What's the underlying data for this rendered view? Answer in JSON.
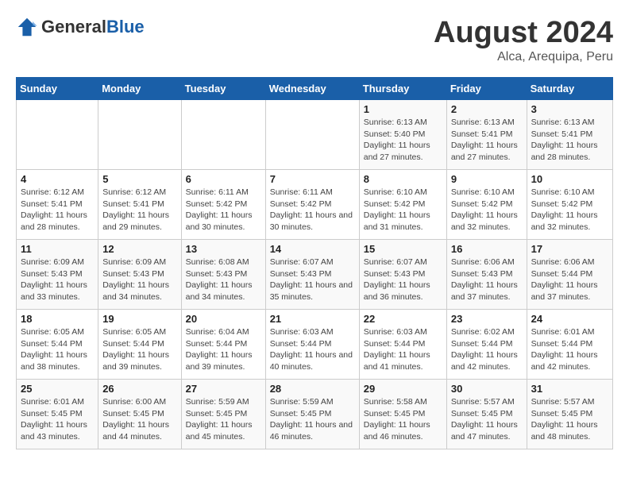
{
  "header": {
    "logo_general": "General",
    "logo_blue": "Blue",
    "main_title": "August 2024",
    "sub_title": "Alca, Arequipa, Peru"
  },
  "days_of_week": [
    "Sunday",
    "Monday",
    "Tuesday",
    "Wednesday",
    "Thursday",
    "Friday",
    "Saturday"
  ],
  "weeks": [
    [
      {
        "num": "",
        "sunrise": "",
        "sunset": "",
        "daylight": ""
      },
      {
        "num": "",
        "sunrise": "",
        "sunset": "",
        "daylight": ""
      },
      {
        "num": "",
        "sunrise": "",
        "sunset": "",
        "daylight": ""
      },
      {
        "num": "",
        "sunrise": "",
        "sunset": "",
        "daylight": ""
      },
      {
        "num": "1",
        "sunrise": "Sunrise: 6:13 AM",
        "sunset": "Sunset: 5:40 PM",
        "daylight": "Daylight: 11 hours and 27 minutes."
      },
      {
        "num": "2",
        "sunrise": "Sunrise: 6:13 AM",
        "sunset": "Sunset: 5:41 PM",
        "daylight": "Daylight: 11 hours and 27 minutes."
      },
      {
        "num": "3",
        "sunrise": "Sunrise: 6:13 AM",
        "sunset": "Sunset: 5:41 PM",
        "daylight": "Daylight: 11 hours and 28 minutes."
      }
    ],
    [
      {
        "num": "4",
        "sunrise": "Sunrise: 6:12 AM",
        "sunset": "Sunset: 5:41 PM",
        "daylight": "Daylight: 11 hours and 28 minutes."
      },
      {
        "num": "5",
        "sunrise": "Sunrise: 6:12 AM",
        "sunset": "Sunset: 5:41 PM",
        "daylight": "Daylight: 11 hours and 29 minutes."
      },
      {
        "num": "6",
        "sunrise": "Sunrise: 6:11 AM",
        "sunset": "Sunset: 5:42 PM",
        "daylight": "Daylight: 11 hours and 30 minutes."
      },
      {
        "num": "7",
        "sunrise": "Sunrise: 6:11 AM",
        "sunset": "Sunset: 5:42 PM",
        "daylight": "Daylight: 11 hours and 30 minutes."
      },
      {
        "num": "8",
        "sunrise": "Sunrise: 6:10 AM",
        "sunset": "Sunset: 5:42 PM",
        "daylight": "Daylight: 11 hours and 31 minutes."
      },
      {
        "num": "9",
        "sunrise": "Sunrise: 6:10 AM",
        "sunset": "Sunset: 5:42 PM",
        "daylight": "Daylight: 11 hours and 32 minutes."
      },
      {
        "num": "10",
        "sunrise": "Sunrise: 6:10 AM",
        "sunset": "Sunset: 5:42 PM",
        "daylight": "Daylight: 11 hours and 32 minutes."
      }
    ],
    [
      {
        "num": "11",
        "sunrise": "Sunrise: 6:09 AM",
        "sunset": "Sunset: 5:43 PM",
        "daylight": "Daylight: 11 hours and 33 minutes."
      },
      {
        "num": "12",
        "sunrise": "Sunrise: 6:09 AM",
        "sunset": "Sunset: 5:43 PM",
        "daylight": "Daylight: 11 hours and 34 minutes."
      },
      {
        "num": "13",
        "sunrise": "Sunrise: 6:08 AM",
        "sunset": "Sunset: 5:43 PM",
        "daylight": "Daylight: 11 hours and 34 minutes."
      },
      {
        "num": "14",
        "sunrise": "Sunrise: 6:07 AM",
        "sunset": "Sunset: 5:43 PM",
        "daylight": "Daylight: 11 hours and 35 minutes."
      },
      {
        "num": "15",
        "sunrise": "Sunrise: 6:07 AM",
        "sunset": "Sunset: 5:43 PM",
        "daylight": "Daylight: 11 hours and 36 minutes."
      },
      {
        "num": "16",
        "sunrise": "Sunrise: 6:06 AM",
        "sunset": "Sunset: 5:43 PM",
        "daylight": "Daylight: 11 hours and 37 minutes."
      },
      {
        "num": "17",
        "sunrise": "Sunrise: 6:06 AM",
        "sunset": "Sunset: 5:44 PM",
        "daylight": "Daylight: 11 hours and 37 minutes."
      }
    ],
    [
      {
        "num": "18",
        "sunrise": "Sunrise: 6:05 AM",
        "sunset": "Sunset: 5:44 PM",
        "daylight": "Daylight: 11 hours and 38 minutes."
      },
      {
        "num": "19",
        "sunrise": "Sunrise: 6:05 AM",
        "sunset": "Sunset: 5:44 PM",
        "daylight": "Daylight: 11 hours and 39 minutes."
      },
      {
        "num": "20",
        "sunrise": "Sunrise: 6:04 AM",
        "sunset": "Sunset: 5:44 PM",
        "daylight": "Daylight: 11 hours and 39 minutes."
      },
      {
        "num": "21",
        "sunrise": "Sunrise: 6:03 AM",
        "sunset": "Sunset: 5:44 PM",
        "daylight": "Daylight: 11 hours and 40 minutes."
      },
      {
        "num": "22",
        "sunrise": "Sunrise: 6:03 AM",
        "sunset": "Sunset: 5:44 PM",
        "daylight": "Daylight: 11 hours and 41 minutes."
      },
      {
        "num": "23",
        "sunrise": "Sunrise: 6:02 AM",
        "sunset": "Sunset: 5:44 PM",
        "daylight": "Daylight: 11 hours and 42 minutes."
      },
      {
        "num": "24",
        "sunrise": "Sunrise: 6:01 AM",
        "sunset": "Sunset: 5:44 PM",
        "daylight": "Daylight: 11 hours and 42 minutes."
      }
    ],
    [
      {
        "num": "25",
        "sunrise": "Sunrise: 6:01 AM",
        "sunset": "Sunset: 5:45 PM",
        "daylight": "Daylight: 11 hours and 43 minutes."
      },
      {
        "num": "26",
        "sunrise": "Sunrise: 6:00 AM",
        "sunset": "Sunset: 5:45 PM",
        "daylight": "Daylight: 11 hours and 44 minutes."
      },
      {
        "num": "27",
        "sunrise": "Sunrise: 5:59 AM",
        "sunset": "Sunset: 5:45 PM",
        "daylight": "Daylight: 11 hours and 45 minutes."
      },
      {
        "num": "28",
        "sunrise": "Sunrise: 5:59 AM",
        "sunset": "Sunset: 5:45 PM",
        "daylight": "Daylight: 11 hours and 46 minutes."
      },
      {
        "num": "29",
        "sunrise": "Sunrise: 5:58 AM",
        "sunset": "Sunset: 5:45 PM",
        "daylight": "Daylight: 11 hours and 46 minutes."
      },
      {
        "num": "30",
        "sunrise": "Sunrise: 5:57 AM",
        "sunset": "Sunset: 5:45 PM",
        "daylight": "Daylight: 11 hours and 47 minutes."
      },
      {
        "num": "31",
        "sunrise": "Sunrise: 5:57 AM",
        "sunset": "Sunset: 5:45 PM",
        "daylight": "Daylight: 11 hours and 48 minutes."
      }
    ]
  ]
}
